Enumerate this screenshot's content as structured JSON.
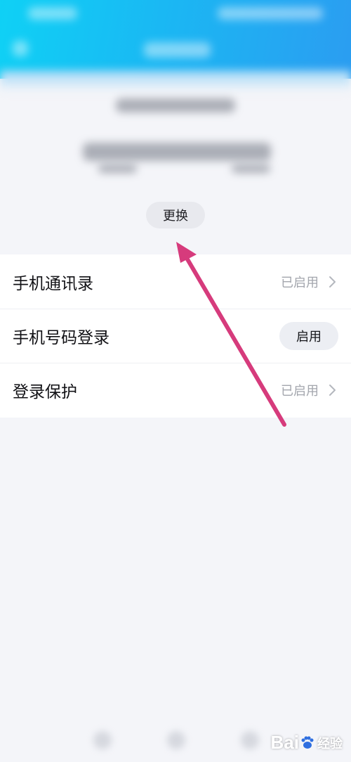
{
  "account": {
    "change_label": "更换"
  },
  "settings": {
    "rows": [
      {
        "label": "手机通讯录",
        "status": "已启用"
      },
      {
        "label": "手机号码登录",
        "button": "启用"
      },
      {
        "label": "登录保护",
        "status": "已启用"
      }
    ]
  },
  "colors": {
    "header_start": "#0fd1f5",
    "header_end": "#2b9df1",
    "annotation_arrow": "#d63b7c",
    "background": "#f4f5f9"
  },
  "watermark": {
    "logo_text": "Bai",
    "sub_text": "经验"
  }
}
